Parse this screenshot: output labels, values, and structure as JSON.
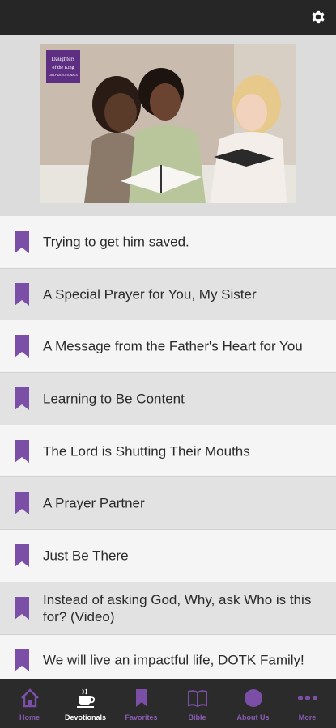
{
  "header": {
    "settings_icon": "gear-icon"
  },
  "hero": {
    "logo_line1": "Daughters",
    "logo_line2": "of the King",
    "logo_line3": "DAILY DEVOTIONALS"
  },
  "devotionals": [
    {
      "title": "Trying to get him saved."
    },
    {
      "title": "A Special Prayer for You, My Sister"
    },
    {
      "title": "A Message from the Father's Heart for You"
    },
    {
      "title": "Learning to Be Content"
    },
    {
      "title": "The Lord is Shutting Their Mouths"
    },
    {
      "title": "A Prayer Partner"
    },
    {
      "title": "Just Be There"
    },
    {
      "title": "Instead of asking God, Why, ask Who is this for? (Video)"
    },
    {
      "title": "We will live an impactful life, DOTK Family!"
    }
  ],
  "tabs": [
    {
      "label": "Home",
      "icon": "home-icon"
    },
    {
      "label": "Devotionals",
      "icon": "coffee-cup-icon"
    },
    {
      "label": "Favorites",
      "icon": "bookmark-icon"
    },
    {
      "label": "Bible",
      "icon": "book-icon"
    },
    {
      "label": "About Us",
      "icon": "circle-icon"
    },
    {
      "label": "More",
      "icon": "more-dots-icon"
    }
  ],
  "colors": {
    "accent": "#7b4fa6",
    "topbar": "#262626",
    "bottombar": "#2b2b2b"
  }
}
